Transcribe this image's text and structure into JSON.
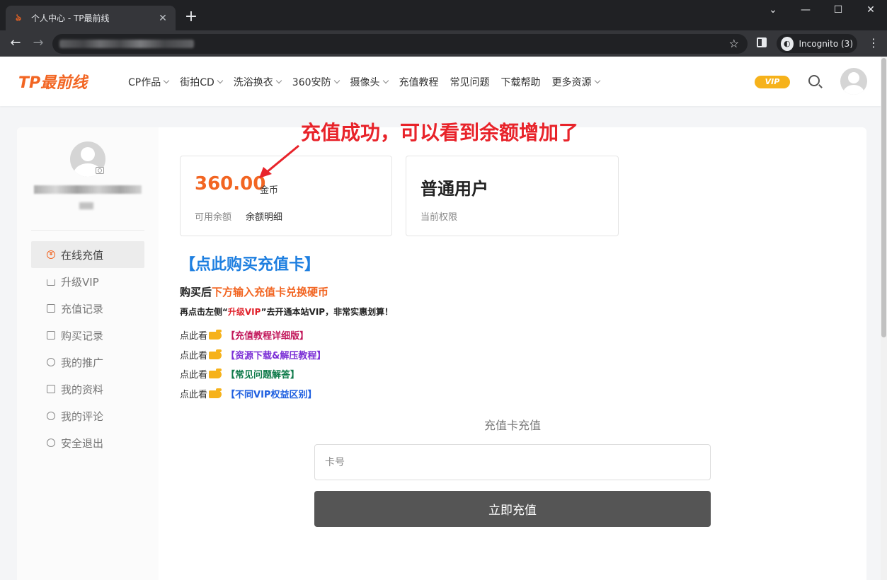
{
  "browser": {
    "tab_title": "个人中心 - TP最前线",
    "incognito_label": "Incognito (3)"
  },
  "header": {
    "logo": "TP最前线",
    "nav": [
      {
        "label": "CP作品",
        "dropdown": true
      },
      {
        "label": "街拍CD",
        "dropdown": true
      },
      {
        "label": "洗浴换衣",
        "dropdown": true
      },
      {
        "label": "360安防",
        "dropdown": true
      },
      {
        "label": "摄像头",
        "dropdown": true
      },
      {
        "label": "充值教程",
        "dropdown": false
      },
      {
        "label": "常见问题",
        "dropdown": false
      },
      {
        "label": "下载帮助",
        "dropdown": false
      },
      {
        "label": "更多资源",
        "dropdown": true
      }
    ],
    "vip_label": "VIP"
  },
  "sidebar": {
    "menu": [
      {
        "label": "在线充值",
        "icon": "yen-icon",
        "active": true
      },
      {
        "label": "升级VIP",
        "icon": "crown-icon",
        "active": false
      },
      {
        "label": "充值记录",
        "icon": "wallet-icon",
        "active": false
      },
      {
        "label": "购买记录",
        "icon": "bag-icon",
        "active": false
      },
      {
        "label": "我的推广",
        "icon": "share-icon",
        "active": false
      },
      {
        "label": "我的资料",
        "icon": "id-card-icon",
        "active": false
      },
      {
        "label": "我的评论",
        "icon": "comment-icon",
        "active": false
      },
      {
        "label": "安全退出",
        "icon": "power-icon",
        "active": false
      }
    ]
  },
  "balance": {
    "amount": "360.00",
    "unit": "金币",
    "label": "可用余额",
    "detail_link": "余额明细"
  },
  "role": {
    "name": "普通用户",
    "label": "当前权限"
  },
  "annotation": "充值成功，可以看到余额增加了",
  "promo": {
    "buy_link": "【点此购买充值卡】",
    "line1_a": "购买后",
    "line1_b": "下方输入充值卡兑换硬币",
    "line2_a": "再点击左侧“",
    "line2_b": "升级VIP",
    "line2_c": "”去开通本站VIP，非常实惠划算！",
    "see_label": "点此看",
    "links": [
      {
        "text": "【充值教程详细版】",
        "color": "#c2185b"
      },
      {
        "text": "【资源下载&解压教程】",
        "color": "#7b2fd6"
      },
      {
        "text": "【常见问题解答】",
        "color": "#0f7a4a"
      },
      {
        "text": "【不同VIP权益区别】",
        "color": "#1e5fe0"
      }
    ]
  },
  "recharge": {
    "title": "充值卡充值",
    "placeholder": "卡号",
    "button": "立即充值"
  }
}
